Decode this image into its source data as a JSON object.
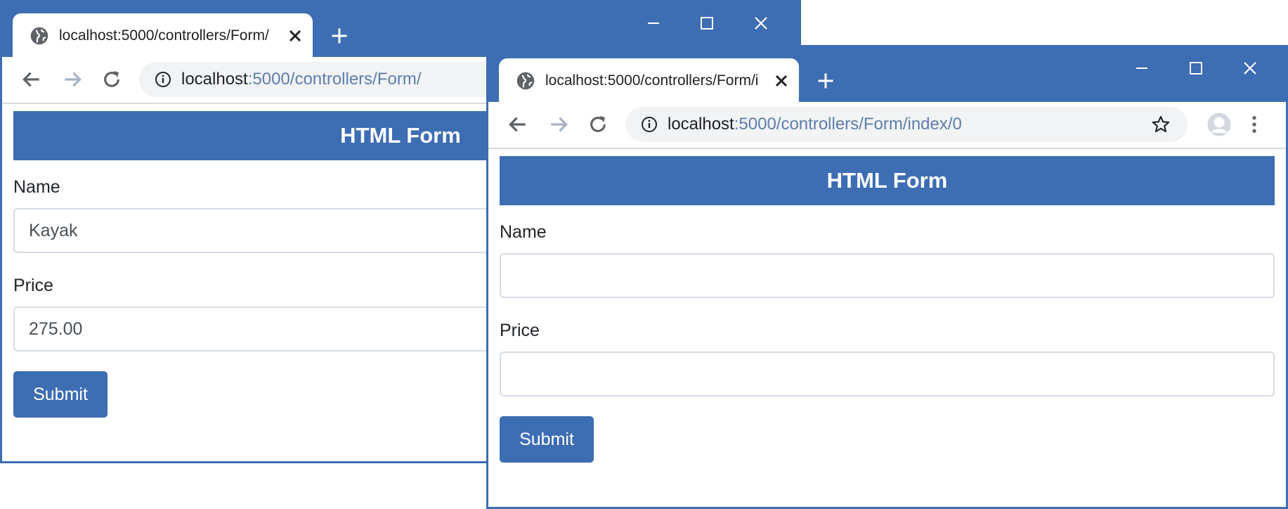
{
  "back_window": {
    "tab_title": "localhost:5000/controllers/Form/",
    "url_host": "localhost",
    "url_rest": ":5000/controllers/Form/",
    "page": {
      "heading": "HTML Form",
      "name_label": "Name",
      "name_value": "Kayak",
      "price_label": "Price",
      "price_value": "275.00",
      "submit_label": "Submit"
    }
  },
  "front_window": {
    "tab_title": "localhost:5000/controllers/Form/i",
    "url_host": "localhost",
    "url_rest": ":5000/controllers/Form/index/0",
    "page": {
      "heading": "HTML Form",
      "name_label": "Name",
      "name_value": "",
      "price_label": "Price",
      "price_value": "",
      "submit_label": "Submit"
    }
  },
  "icons": {
    "tab": [
      "globe-icon",
      "close-icon"
    ],
    "toolbar": [
      "plus-icon",
      "minimize-icon",
      "maximize-icon",
      "close-icon",
      "back-arrow-icon",
      "forward-arrow-icon",
      "reload-icon",
      "info-icon",
      "star-icon",
      "avatar-icon",
      "kebab-menu-icon"
    ]
  },
  "colors": {
    "brand_blue": "#3d6db3",
    "url_gray_blue": "#5f7dad",
    "input_border": "#d5dce4"
  }
}
